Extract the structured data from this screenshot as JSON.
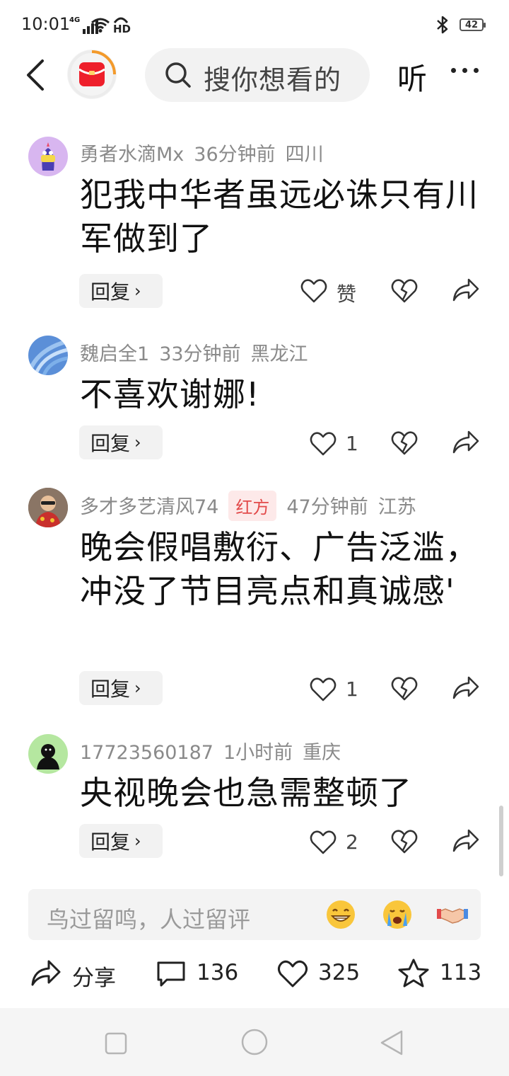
{
  "status": {
    "time": "10:01",
    "network": "4G",
    "hd": "HD",
    "battery": "42"
  },
  "header": {
    "search_placeholder": "搜你想看的",
    "listen": "听"
  },
  "comments": [
    {
      "user": "勇者水滴Mx",
      "time": "36分钟前",
      "region": "四川",
      "text": "犯我中华者虽远必诛只有川军做到了",
      "like": "赞",
      "reply": "回复"
    },
    {
      "user": "魏启全1",
      "time": "33分钟前",
      "region": "黑龙江",
      "text": "不喜欢谢娜!",
      "like": "1",
      "reply": "回复"
    },
    {
      "user": "多才多艺清风74",
      "tag": "红方",
      "time": "47分钟前",
      "region": "江苏",
      "text": "晚会假唱敷衍、广告泛滥，冲没了节目亮点和真诚感'",
      "like": "1",
      "reply": "回复"
    },
    {
      "user": "17723560187",
      "time": "1小时前",
      "region": "重庆",
      "text": "央视晚会也急需整顿了",
      "like": "2",
      "reply": "回复"
    }
  ],
  "input": {
    "placeholder": "鸟过留鸣，人过留评"
  },
  "actions": {
    "share": "分享",
    "comments": "136",
    "likes": "325",
    "favorites": "113"
  },
  "colors": {
    "tag_bg": "#fde9e9",
    "tag_fg": "#e24a4a",
    "logo_red": "#ee1f2b",
    "logo_ring": "#f39a2b"
  }
}
